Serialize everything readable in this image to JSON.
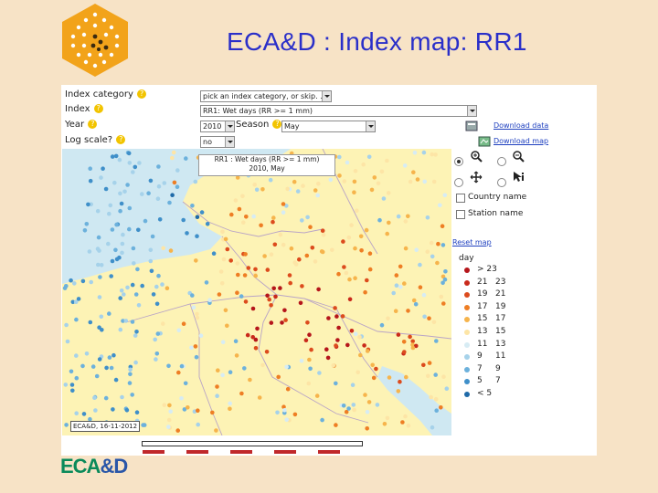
{
  "slide": {
    "title": "ECA&D : Index map: RR1",
    "footer_logo_left": "ECA",
    "footer_logo_right": "&D"
  },
  "controls": {
    "index_category_label": "Index category",
    "index_category_value": "pick an index category, or skip. .",
    "index_label": "Index",
    "index_value": "RR1: Wet days (RR >= 1 mm)",
    "year_label": "Year",
    "year_value": "2010",
    "season_label": "Season",
    "season_value": "May",
    "log_scale_label": "Log scale?",
    "log_scale_value": "no",
    "help_symbol": "?"
  },
  "sidebar": {
    "download_data": "Download data",
    "download_map": "Download map",
    "country_name": "Country name",
    "station_name": "Station name",
    "reset_map": "Reset map"
  },
  "map": {
    "caption_line1": "RR1 : Wet days (RR >= 1 mm)",
    "caption_line2": "2010, May",
    "date_label": "ECA&D, 16-11-2012"
  },
  "legend": {
    "unit": "day",
    "classes": [
      {
        "from": "> 23",
        "to": "",
        "color": "#b5161b"
      },
      {
        "from": "21",
        "to": "23",
        "color": "#c9291b"
      },
      {
        "from": "19",
        "to": "21",
        "color": "#dc4b1d"
      },
      {
        "from": "17",
        "to": "19",
        "color": "#ee7e24"
      },
      {
        "from": "15",
        "to": "17",
        "color": "#f6b44c"
      },
      {
        "from": "13",
        "to": "15",
        "color": "#fde5a6"
      },
      {
        "from": "11",
        "to": "13",
        "color": "#d7ecf4"
      },
      {
        "from": "9",
        "to": "11",
        "color": "#a6d2ea"
      },
      {
        "from": "7",
        "to": "9",
        "color": "#6cb1dc"
      },
      {
        "from": "5",
        "to": "7",
        "color": "#3f8fc9"
      },
      {
        "from": "< 5",
        "to": "",
        "color": "#1f6aa8"
      }
    ]
  },
  "colors": {
    "background": "#f7e3c6",
    "title": "#2a2fc9",
    "land": "#fdf3b5",
    "sea": "#cfe8f2",
    "border": "#b9a4c6"
  }
}
